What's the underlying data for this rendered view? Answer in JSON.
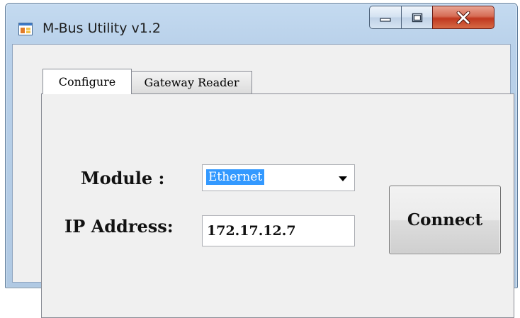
{
  "window": {
    "title": "M-Bus Utility v1.2",
    "icon": "app-window-icon",
    "controls": {
      "minimize_icon": "minimize-icon",
      "maximize_icon": "maximize-icon",
      "close_icon": "close-icon"
    }
  },
  "tabs": [
    {
      "label": "Configure",
      "selected": true
    },
    {
      "label": "Gateway Reader",
      "selected": false
    }
  ],
  "form": {
    "module_label": "Module :",
    "module_value": "Ethernet",
    "ip_label": "IP Address:",
    "ip_value": "172.17.12.7",
    "connect_label": "Connect"
  },
  "colors": {
    "selection": "#3399ff",
    "close_button": "#c7452b",
    "panel": "#f0f0f0",
    "frame": "#b9d1ea"
  }
}
